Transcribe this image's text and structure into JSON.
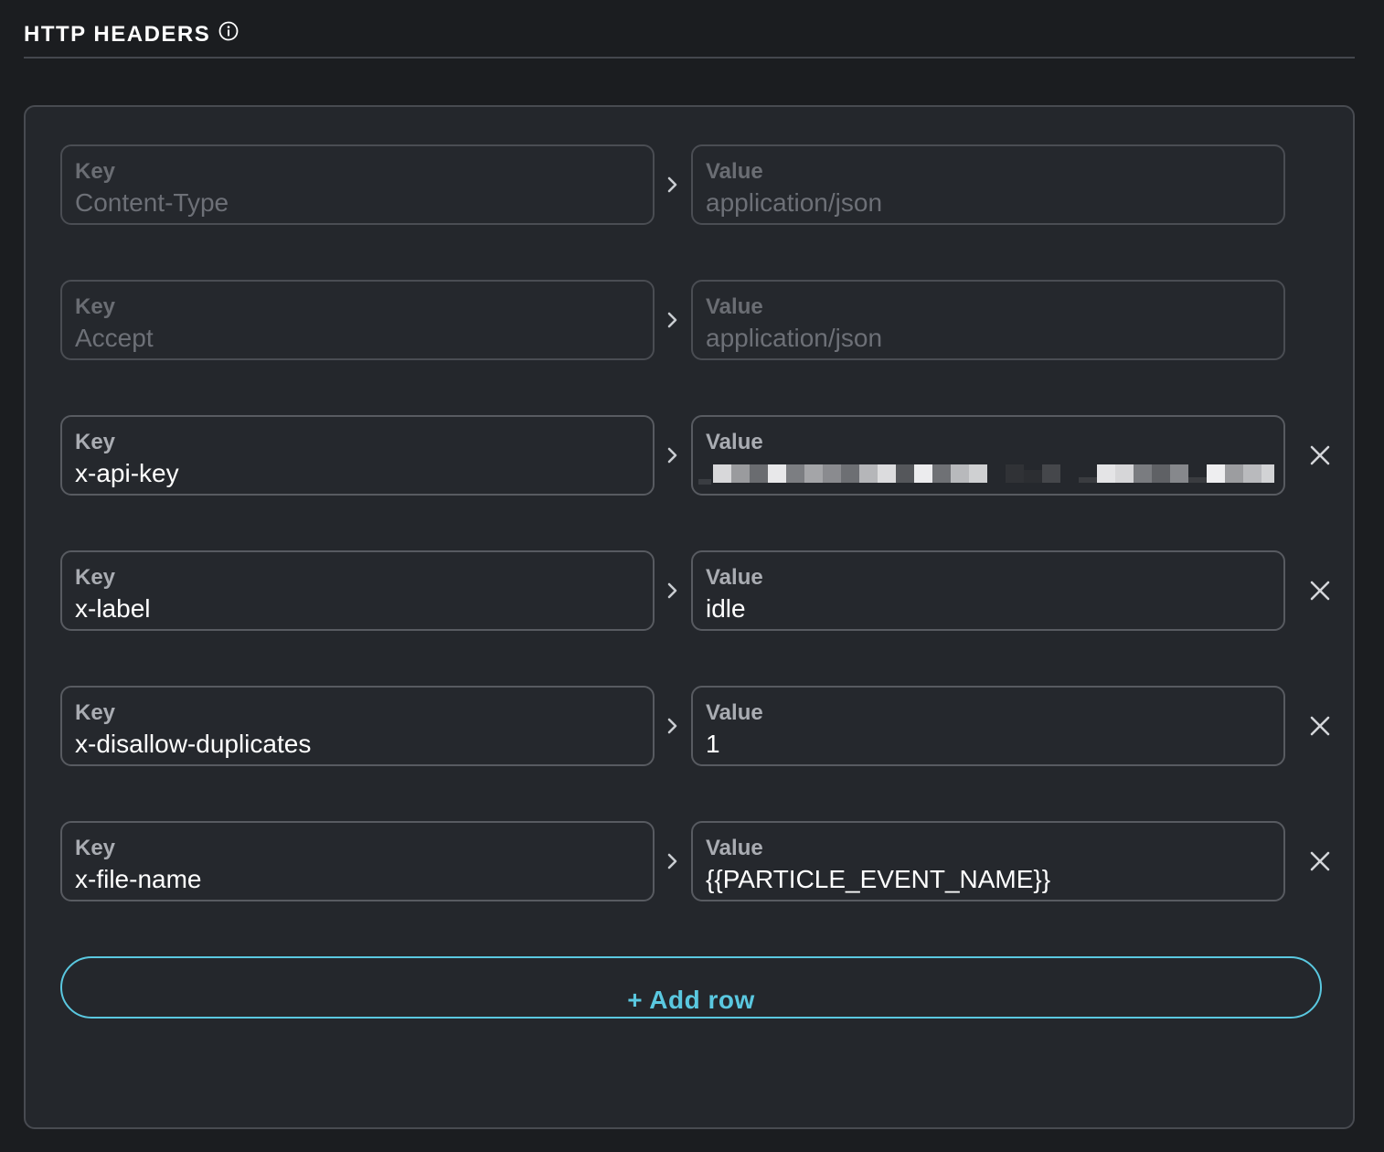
{
  "section": {
    "title": "HTTP HEADERS",
    "info_icon": "info-circle-icon"
  },
  "labels": {
    "key": "Key",
    "value": "Value"
  },
  "headers": [
    {
      "key": "Content-Type",
      "value": "application/json",
      "editable": false
    },
    {
      "key": "Accept",
      "value": "application/json",
      "editable": false
    },
    {
      "key": "x-api-key",
      "value": "",
      "value_masked": true,
      "editable": true
    },
    {
      "key": "x-label",
      "value": "idle",
      "editable": true
    },
    {
      "key": "x-disallow-duplicates",
      "value": "1",
      "editable": true
    },
    {
      "key": "x-file-name",
      "value": "{{PARTICLE_EVENT_NAME}}",
      "editable": true
    }
  ],
  "add_row_label": "+ Add row",
  "colors": {
    "background": "#1b1d20",
    "panel": "#24272c",
    "accent": "#5ac8e0",
    "border": "#585b61"
  }
}
